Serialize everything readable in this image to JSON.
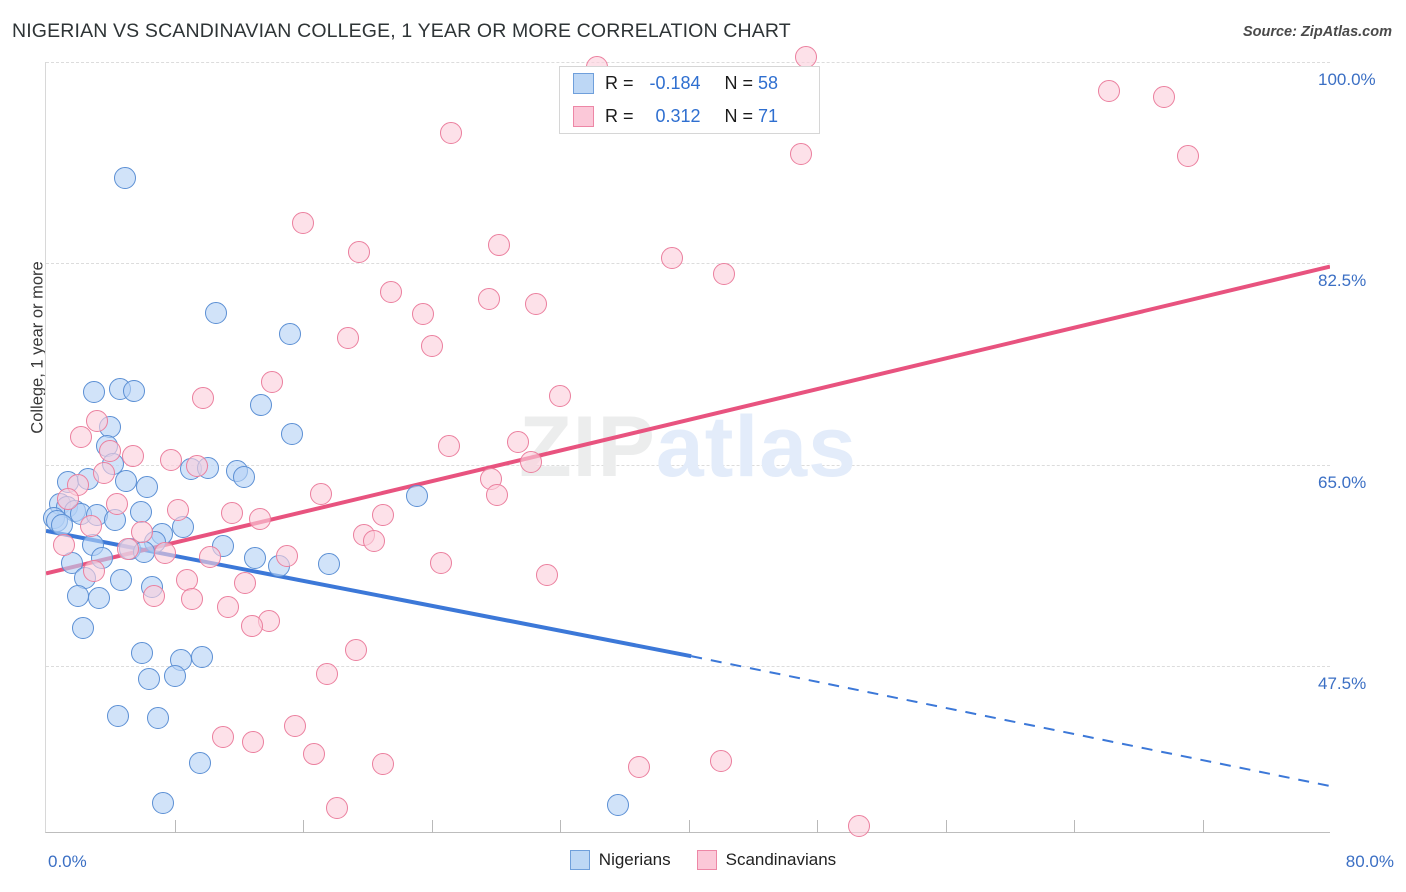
{
  "header": {
    "title": "NIGERIAN VS SCANDINAVIAN COLLEGE, 1 YEAR OR MORE CORRELATION CHART",
    "source": "Source: ZipAtlas.com"
  },
  "watermark": {
    "part1": "ZIP",
    "part2": "atlas"
  },
  "stats": {
    "rows": [
      {
        "series": "Nigerians",
        "r_label": "R =",
        "r_value": "-0.184",
        "n_label": "N =",
        "n_value": "58",
        "color": "#bdd7f5"
      },
      {
        "series": "Scandinavians",
        "r_label": "R =",
        "r_value": "0.312",
        "n_label": "N =",
        "n_value": "71",
        "color": "#fbc8d8"
      }
    ]
  },
  "series_legend": [
    {
      "label": "Nigerians",
      "color": "#bdd7f5"
    },
    {
      "label": "Scandinavians",
      "color": "#fbc8d8"
    }
  ],
  "chart_data": {
    "type": "scatter",
    "title": "NIGERIAN VS SCANDINAVIAN COLLEGE, 1 YEAR OR MORE CORRELATION CHART",
    "xlabel": "",
    "ylabel": "College, 1 year or more",
    "xlim": [
      0,
      80
    ],
    "ylim": [
      33.0,
      100.0
    ],
    "x_tick_labels": [
      "0.0%",
      "80.0%"
    ],
    "y_tick_labels": [
      "100.0%",
      "82.5%",
      "65.0%",
      "47.5%"
    ],
    "y_tick_values": [
      100.0,
      82.5,
      65.0,
      47.5
    ],
    "grid": true,
    "legend_position": "bottom-center",
    "accent_colors": {
      "nigerians": "#3c78d8",
      "scandinavians": "#e8537f",
      "tick_text": "#3b6fc4"
    },
    "series": [
      {
        "name": "Nigerians",
        "color": "#bdd7f5",
        "edge_color": "#5b8fd4",
        "r": -0.184,
        "n": 58,
        "trendline": {
          "style": "solid-then-dashed",
          "x_solid_end": 40.2,
          "points": [
            [
              0,
              59.2
            ],
            [
              40.2,
              48.3
            ],
            [
              80,
              37.0
            ]
          ]
        },
        "points": [
          [
            4.9,
            89.9
          ],
          [
            10.6,
            78.2
          ],
          [
            15.2,
            76.4
          ],
          [
            3.0,
            71.3
          ],
          [
            4.6,
            71.6
          ],
          [
            5.5,
            71.4
          ],
          [
            13.4,
            70.2
          ],
          [
            15.3,
            67.7
          ],
          [
            4.0,
            68.3
          ],
          [
            3.8,
            66.6
          ],
          [
            4.2,
            65.1
          ],
          [
            9.0,
            64.6
          ],
          [
            10.1,
            64.7
          ],
          [
            11.9,
            64.5
          ],
          [
            1.4,
            63.5
          ],
          [
            2.6,
            63.8
          ],
          [
            5.0,
            63.6
          ],
          [
            6.3,
            63.1
          ],
          [
            23.1,
            62.3
          ],
          [
            0.9,
            61.6
          ],
          [
            1.3,
            61.3
          ],
          [
            1.8,
            61.0
          ],
          [
            2.2,
            60.7
          ],
          [
            0.5,
            60.4
          ],
          [
            0.7,
            60.1
          ],
          [
            1.0,
            59.8
          ],
          [
            3.2,
            60.6
          ],
          [
            4.3,
            60.2
          ],
          [
            5.9,
            60.9
          ],
          [
            7.2,
            59.0
          ],
          [
            8.5,
            59.6
          ],
          [
            6.8,
            58.3
          ],
          [
            2.9,
            58.0
          ],
          [
            5.2,
            57.7
          ],
          [
            6.1,
            57.4
          ],
          [
            3.5,
            56.9
          ],
          [
            1.6,
            56.5
          ],
          [
            13.0,
            56.9
          ],
          [
            14.5,
            56.2
          ],
          [
            17.6,
            56.4
          ],
          [
            2.4,
            55.2
          ],
          [
            4.7,
            55.0
          ],
          [
            6.6,
            54.4
          ],
          [
            2.0,
            53.6
          ],
          [
            3.3,
            53.4
          ],
          [
            2.3,
            50.8
          ],
          [
            6.0,
            48.6
          ],
          [
            8.4,
            48.0
          ],
          [
            9.7,
            48.3
          ],
          [
            6.4,
            46.4
          ],
          [
            8.0,
            46.6
          ],
          [
            4.5,
            43.2
          ],
          [
            7.0,
            43.0
          ],
          [
            9.6,
            39.1
          ],
          [
            7.3,
            35.6
          ],
          [
            35.6,
            35.4
          ],
          [
            12.3,
            63.9
          ],
          [
            11.0,
            57.9
          ]
        ]
      },
      {
        "name": "Scandinavians",
        "color": "#fbc8d8",
        "edge_color": "#eb7f9e",
        "r": 0.312,
        "n": 71,
        "trendline": {
          "style": "solid",
          "points": [
            [
              0,
              55.5
            ],
            [
              80,
              82.2
            ]
          ]
        },
        "points": [
          [
            34.3,
            99.6
          ],
          [
            47.3,
            100.4
          ],
          [
            66.2,
            97.5
          ],
          [
            69.6,
            97.0
          ],
          [
            71.1,
            91.8
          ],
          [
            25.2,
            93.8
          ],
          [
            47.0,
            92.0
          ],
          [
            16.0,
            86.0
          ],
          [
            19.5,
            83.5
          ],
          [
            28.2,
            84.1
          ],
          [
            39.0,
            83.0
          ],
          [
            42.2,
            81.6
          ],
          [
            21.5,
            80.0
          ],
          [
            27.6,
            79.4
          ],
          [
            30.5,
            79.0
          ],
          [
            23.5,
            78.1
          ],
          [
            18.8,
            76.0
          ],
          [
            24.0,
            75.3
          ],
          [
            32.0,
            71.0
          ],
          [
            14.1,
            72.2
          ],
          [
            9.8,
            70.8
          ],
          [
            3.2,
            68.8
          ],
          [
            2.2,
            67.4
          ],
          [
            4.0,
            66.2
          ],
          [
            25.1,
            66.6
          ],
          [
            29.4,
            67.0
          ],
          [
            30.2,
            65.2
          ],
          [
            5.4,
            65.8
          ],
          [
            7.8,
            65.4
          ],
          [
            9.4,
            64.9
          ],
          [
            3.6,
            64.3
          ],
          [
            2.0,
            63.2
          ],
          [
            27.7,
            63.8
          ],
          [
            28.1,
            62.4
          ],
          [
            17.1,
            62.5
          ],
          [
            1.4,
            62.0
          ],
          [
            4.4,
            61.6
          ],
          [
            8.2,
            61.1
          ],
          [
            11.6,
            60.8
          ],
          [
            13.3,
            60.3
          ],
          [
            21.0,
            60.6
          ],
          [
            2.8,
            59.7
          ],
          [
            6.0,
            59.2
          ],
          [
            19.8,
            58.9
          ],
          [
            20.4,
            58.4
          ],
          [
            1.1,
            58.0
          ],
          [
            5.1,
            57.7
          ],
          [
            7.4,
            57.3
          ],
          [
            10.2,
            57.0
          ],
          [
            15.0,
            57.1
          ],
          [
            24.6,
            56.5
          ],
          [
            31.2,
            55.4
          ],
          [
            3.0,
            55.8
          ],
          [
            8.8,
            55.0
          ],
          [
            12.4,
            54.7
          ],
          [
            6.7,
            53.6
          ],
          [
            9.1,
            53.3
          ],
          [
            11.3,
            52.6
          ],
          [
            13.9,
            51.4
          ],
          [
            12.8,
            51.0
          ],
          [
            19.3,
            48.9
          ],
          [
            17.5,
            46.8
          ],
          [
            15.5,
            42.3
          ],
          [
            11.0,
            41.3
          ],
          [
            12.9,
            40.9
          ],
          [
            16.7,
            39.9
          ],
          [
            21.0,
            39.0
          ],
          [
            36.9,
            38.7
          ],
          [
            42.0,
            39.3
          ],
          [
            18.1,
            35.2
          ],
          [
            50.6,
            33.6
          ]
        ]
      }
    ]
  },
  "axis": {
    "y_title": "College, 1 year or more",
    "x_min_label": "0.0%",
    "x_max_label": "80.0%"
  }
}
